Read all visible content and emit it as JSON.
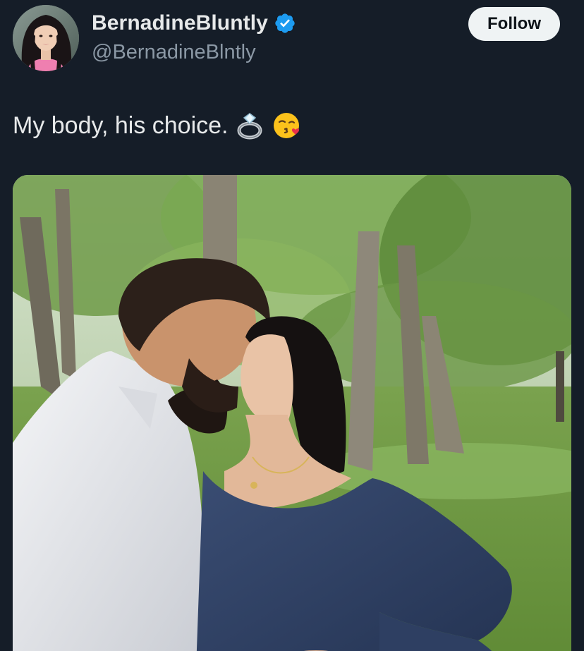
{
  "tweet": {
    "author": {
      "display_name": "BernadineBluntly",
      "handle": "@BernadineBlntly",
      "verified": true,
      "avatar_icon": "profile-avatar",
      "verified_icon": "verified-badge-icon"
    },
    "follow_label": "Follow",
    "text": "My body, his choice.",
    "emojis": [
      "ring-emoji",
      "face-blowing-kiss-emoji"
    ],
    "media": {
      "type": "photo",
      "subject": "couple-kissing-photo"
    }
  },
  "colors": {
    "background": "#151d28",
    "text_primary": "#e7e9ea",
    "text_secondary": "#8b98a5",
    "verified_blue": "#1d9bf0",
    "follow_button_bg": "#eff3f4",
    "follow_button_text": "#0f1419"
  }
}
